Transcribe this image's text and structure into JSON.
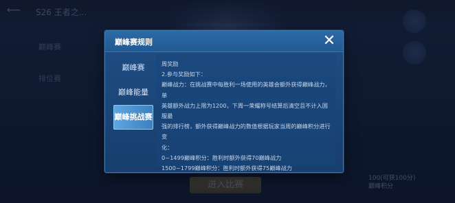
{
  "background": {
    "header_title": "S26 王者之...",
    "left_items": [
      "巅峰赛",
      "排位赛"
    ],
    "enter_button_label": "进入比赛",
    "bottom_right_line1": "100(可获100分)",
    "bottom_right_line2": "巅峰积分"
  },
  "modal": {
    "title": "巅峰赛规则",
    "close_label": "✕",
    "tabs": [
      {
        "label": "巅峰赛",
        "active": false
      },
      {
        "label": "巅峰能量",
        "active": false
      },
      {
        "label": "巅峰挑战赛",
        "active": true
      }
    ],
    "content_lines": [
      "周奖励",
      "2.参与奖励如下：",
      "巅峰战力：在挑战赛中每胜利一场使用的英雄会额外获得巅峰战力，单",
      "英雄额外战力上限为1200，下周一荣耀称号结算后清空且不计入国服最",
      "强的排行榜，额外获得巅峰战力的数值根据玩家当周的巅峰积分进行变",
      "化：",
      "0~1499巅峰积分：胜利时额外获得70巅峰战力",
      "1500~1799巅峰积分：胜利时额外获得75巅峰战力"
    ]
  }
}
